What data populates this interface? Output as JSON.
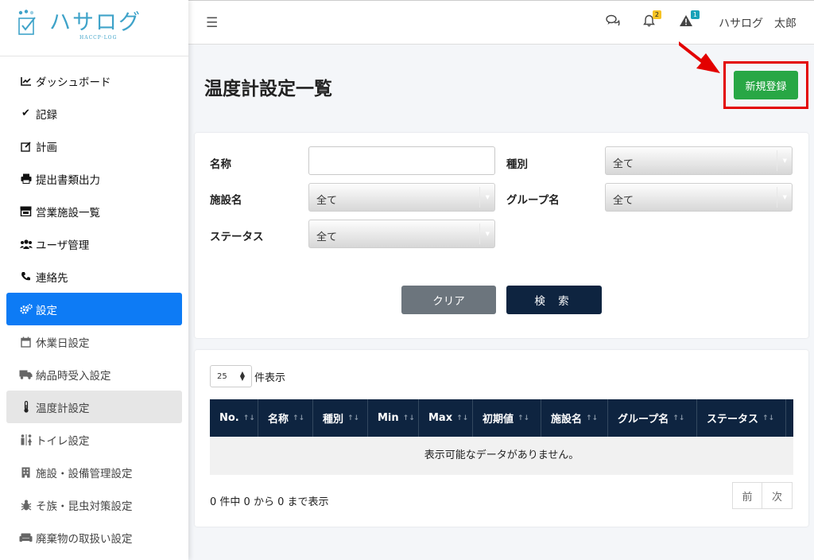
{
  "brand": {
    "name": "ハサログ",
    "sub": "HACCP·LOG"
  },
  "sidebar": {
    "items": [
      {
        "label": "ダッシュボード",
        "icon": "chart-line-icon"
      },
      {
        "label": "記録",
        "icon": "check-icon"
      },
      {
        "label": "計画",
        "icon": "edit-icon"
      },
      {
        "label": "提出書類出力",
        "icon": "print-icon"
      },
      {
        "label": "営業施設一覧",
        "icon": "store-icon"
      },
      {
        "label": "ユーザ管理",
        "icon": "users-icon"
      },
      {
        "label": "連絡先",
        "icon": "phone-icon"
      },
      {
        "label": "設定",
        "icon": "cogs-icon"
      },
      {
        "label": "休業日設定",
        "icon": "calendar-icon"
      },
      {
        "label": "納品時受入設定",
        "icon": "truck-icon"
      },
      {
        "label": "温度計設定",
        "icon": "thermometer-icon"
      },
      {
        "label": "トイレ設定",
        "icon": "restroom-icon"
      },
      {
        "label": "施設・設備管理設定",
        "icon": "building-icon"
      },
      {
        "label": "そ族・昆虫対策設定",
        "icon": "bug-icon"
      },
      {
        "label": "廃棄物の取扱い設定",
        "icon": "couch-icon"
      }
    ]
  },
  "topbar": {
    "notifications_count": "2",
    "alerts_count": "1",
    "user_name": "ハサログ　太郎"
  },
  "page": {
    "title": "温度計設定一覧",
    "new_button": "新規登録"
  },
  "filters": {
    "name_label": "名称",
    "name_value": "",
    "type_label": "種別",
    "type_value": "全て",
    "facility_label": "施設名",
    "facility_value": "全て",
    "group_label": "グループ名",
    "group_value": "全て",
    "status_label": "ステータス",
    "status_value": "全て",
    "clear_button": "クリア",
    "search_button": "検 索"
  },
  "table": {
    "page_length": "25",
    "page_length_label": "件表示",
    "columns": [
      "No.",
      "名称",
      "種別",
      "Min",
      "Max",
      "初期値",
      "施設名",
      "グループ名",
      "ステータス"
    ],
    "empty_message": "表示可能なデータがありません。",
    "info": "0 件中 0 から 0 まで表示",
    "prev": "前",
    "next": "次"
  },
  "colors": {
    "active_nav": "#0d7bf5",
    "primary_dark": "#0e2440",
    "success": "#28a745",
    "highlight_red": "#e30000",
    "brand_blue": "#3fa3c9"
  }
}
